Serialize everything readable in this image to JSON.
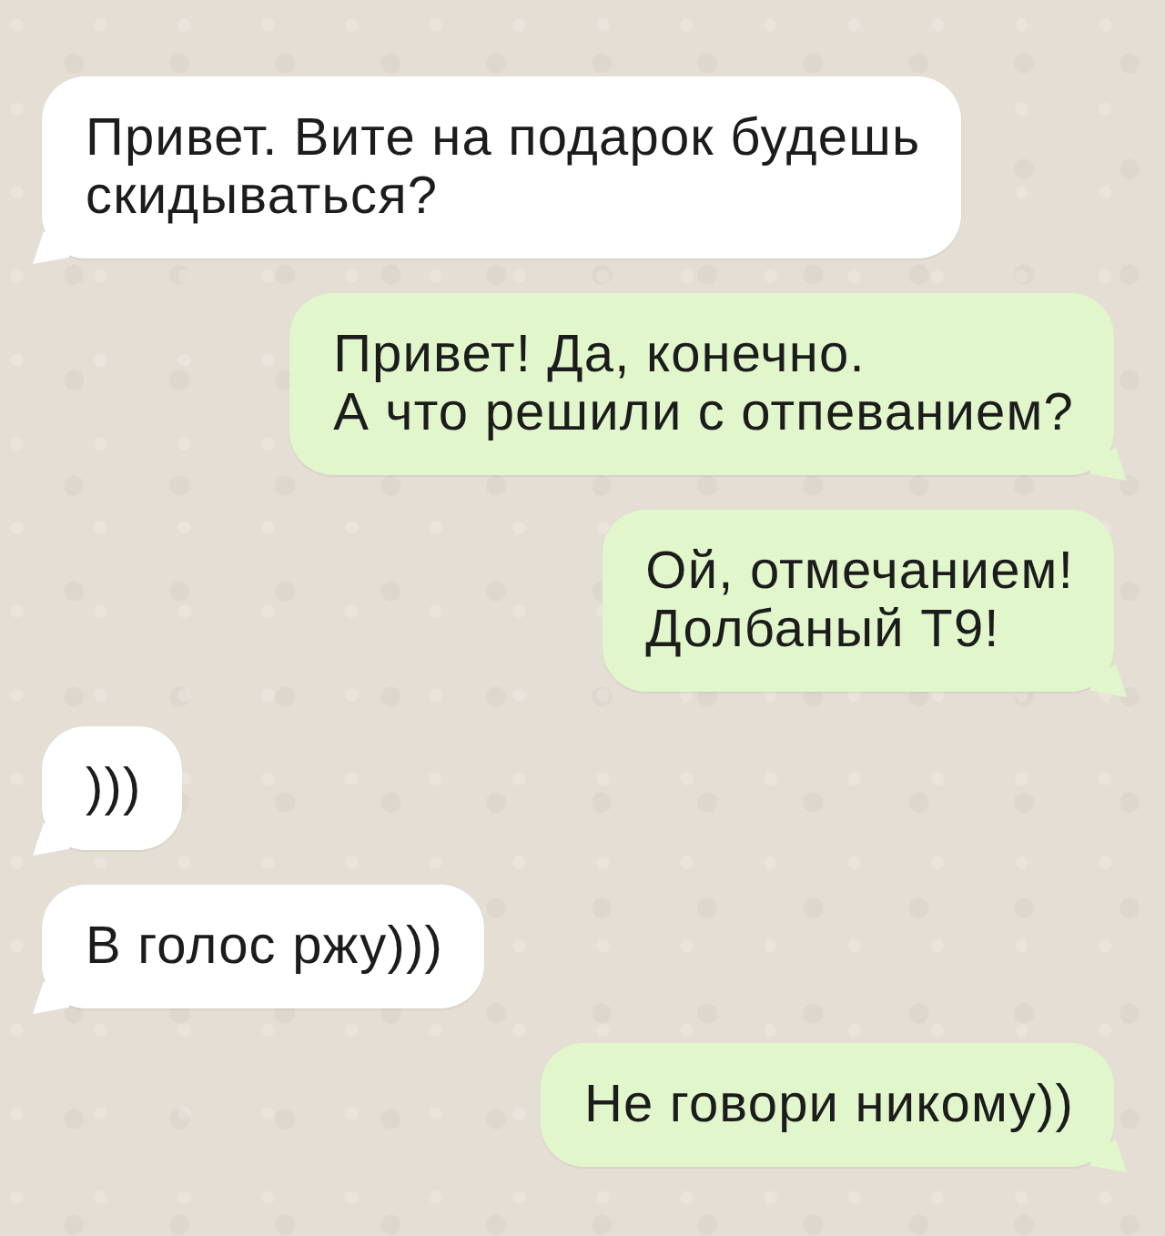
{
  "messages": [
    {
      "kind": "incoming",
      "text": "Привет. Вите на подарок будешь\nскидываться?"
    },
    {
      "kind": "outgoing",
      "text": "Привет! Да, конечно.\nА что решили с отпеванием?"
    },
    {
      "kind": "outgoing",
      "text": "Ой, отмечанием!\nДолбаный Т9!"
    },
    {
      "kind": "incoming",
      "text": ")))"
    },
    {
      "kind": "incoming",
      "text": "В голос ржу)))"
    },
    {
      "kind": "outgoing",
      "text": "Не говори никому))"
    }
  ]
}
